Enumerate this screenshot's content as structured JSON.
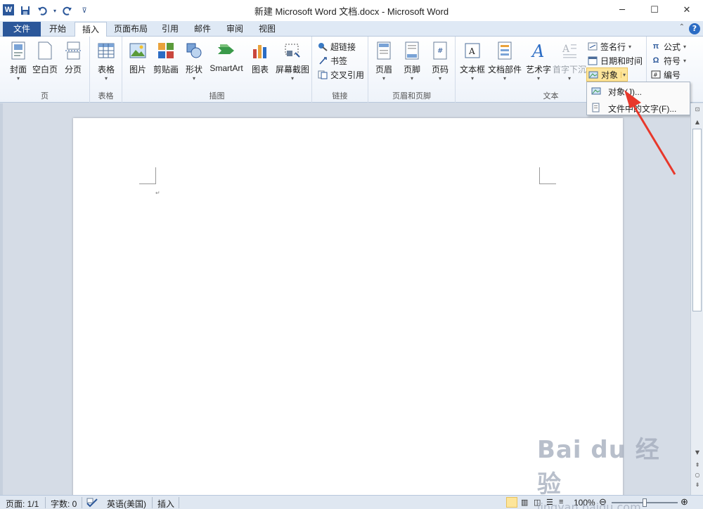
{
  "window": {
    "title": "新建 Microsoft Word 文档.docx - Microsoft Word",
    "app_icon_letter": "W",
    "controls": {
      "minimize": "─",
      "maximize": "☐",
      "close": "✕"
    }
  },
  "quick_access": {
    "save_icon": "save-icon",
    "undo_icon": "undo-icon",
    "redo_icon": "redo-icon",
    "customize": "⊽"
  },
  "tabs": {
    "file": "文件",
    "items": [
      "开始",
      "插入",
      "页面布局",
      "引用",
      "邮件",
      "审阅",
      "视图"
    ],
    "active": "插入",
    "help": "?",
    "minimize": "⌃"
  },
  "ribbon": {
    "groups": {
      "page": "页",
      "table": "表格",
      "illustrations": "插图",
      "links": "链接",
      "header_footer": "页眉和页脚",
      "text": "文本"
    },
    "page": {
      "cover": "封面",
      "blank": "空白页",
      "break": "分页"
    },
    "table": {
      "table": "表格"
    },
    "illustrations": {
      "picture": "图片",
      "clipart": "剪贴画",
      "shapes": "形状",
      "smartart": "SmartArt",
      "chart": "图表",
      "screenshot": "屏幕截图"
    },
    "links": {
      "hyperlink": "超链接",
      "bookmark": "书签",
      "crossref": "交叉引用"
    },
    "header_footer": {
      "header": "页眉",
      "footer": "页脚",
      "page_number": "页码"
    },
    "text": {
      "textbox": "文本框",
      "quickparts": "文档部件",
      "wordart": "艺术字",
      "dropcap": "首字下沉",
      "signature": "签名行",
      "datetime": "日期和时间",
      "object": "对象"
    },
    "symbols": {
      "equation": "公式",
      "symbol": "符号",
      "numbering": "编号"
    }
  },
  "object_menu": {
    "items": [
      "对象(J)...",
      "文件中的文字(F)..."
    ]
  },
  "document": {
    "paragraph_mark": "↵"
  },
  "statusbar": {
    "page": "页面: 1/1",
    "words": "字数: 0",
    "language": "英语(美国)",
    "mode": "插入",
    "zoom": "100%",
    "zoom_level": 1.0
  },
  "watermark": {
    "logo": "Bai du 经验",
    "url": "jingyan.baidu.com"
  },
  "colors": {
    "accent": "#2b579a",
    "highlight": "#fde59a",
    "arrow": "#e8382b"
  }
}
